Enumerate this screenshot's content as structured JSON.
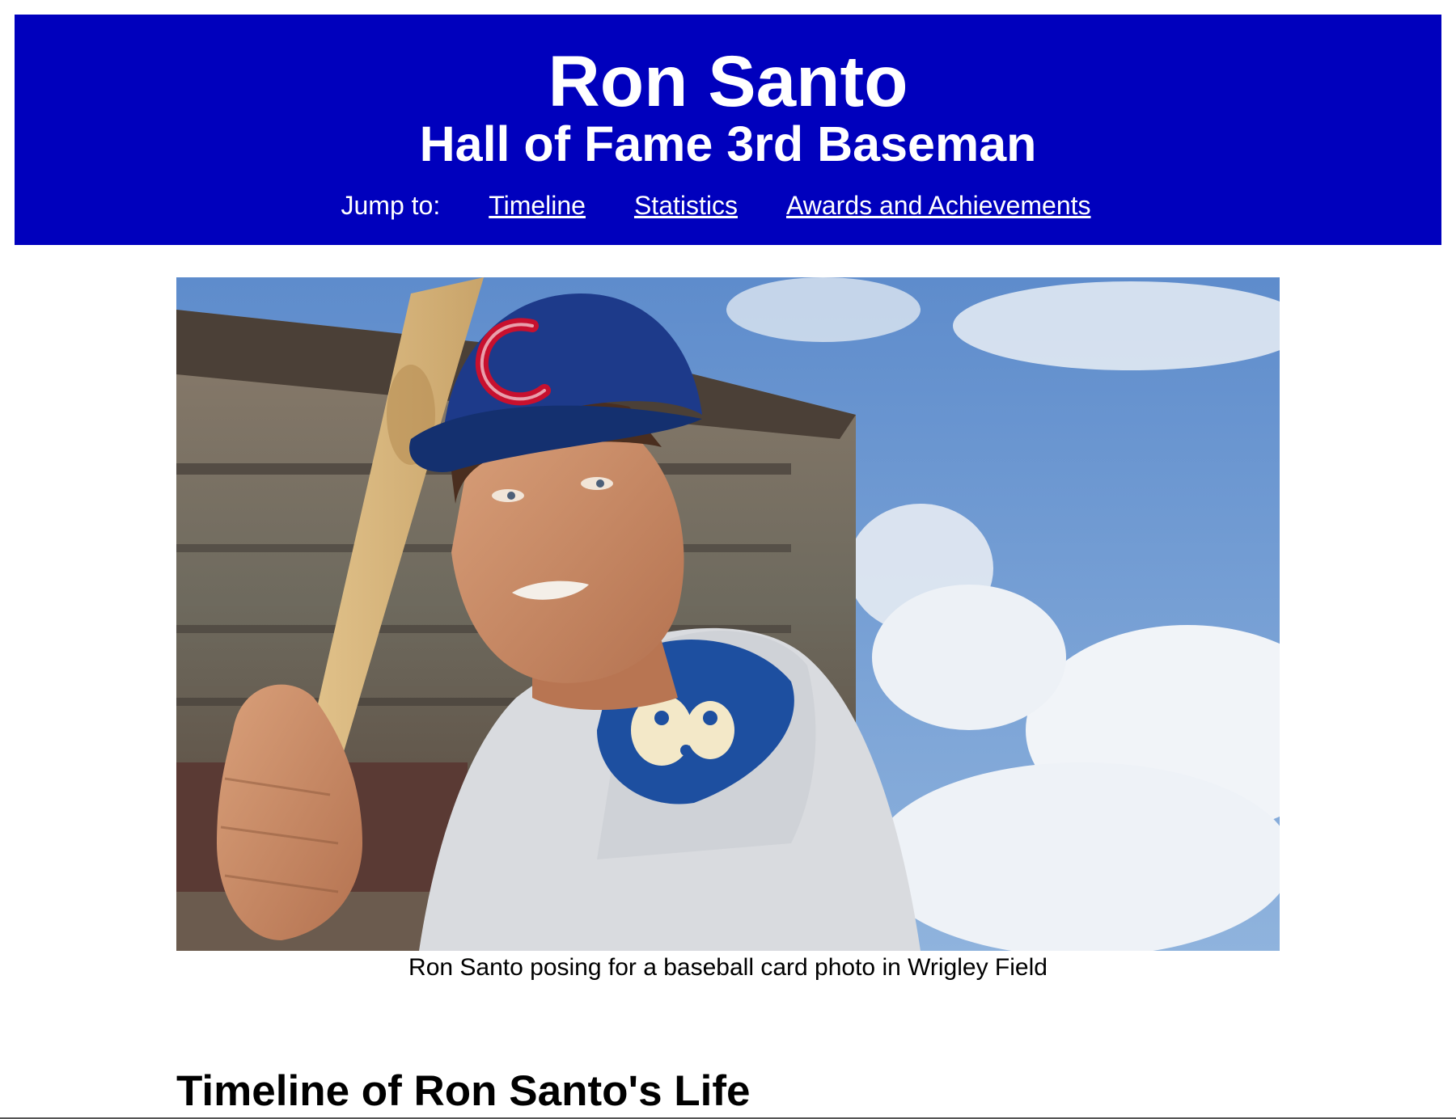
{
  "header": {
    "title": "Ron Santo",
    "subtitle": "Hall of Fame 3rd Baseman",
    "nav_label": "Jump to:",
    "nav_links": [
      "Timeline",
      "Statistics",
      "Awards and Achievements"
    ]
  },
  "photo": {
    "caption": "Ron Santo posing for a baseball card photo in Wrigley Field"
  },
  "section": {
    "title": "Timeline of Ron Santo's Life"
  },
  "colors": {
    "header_bg": "#0000bd",
    "header_text": "#ffffff",
    "cap_blue": "#1d3a8a",
    "logo_red": "#c8102e",
    "sky_blue": "#6f9bd1"
  }
}
